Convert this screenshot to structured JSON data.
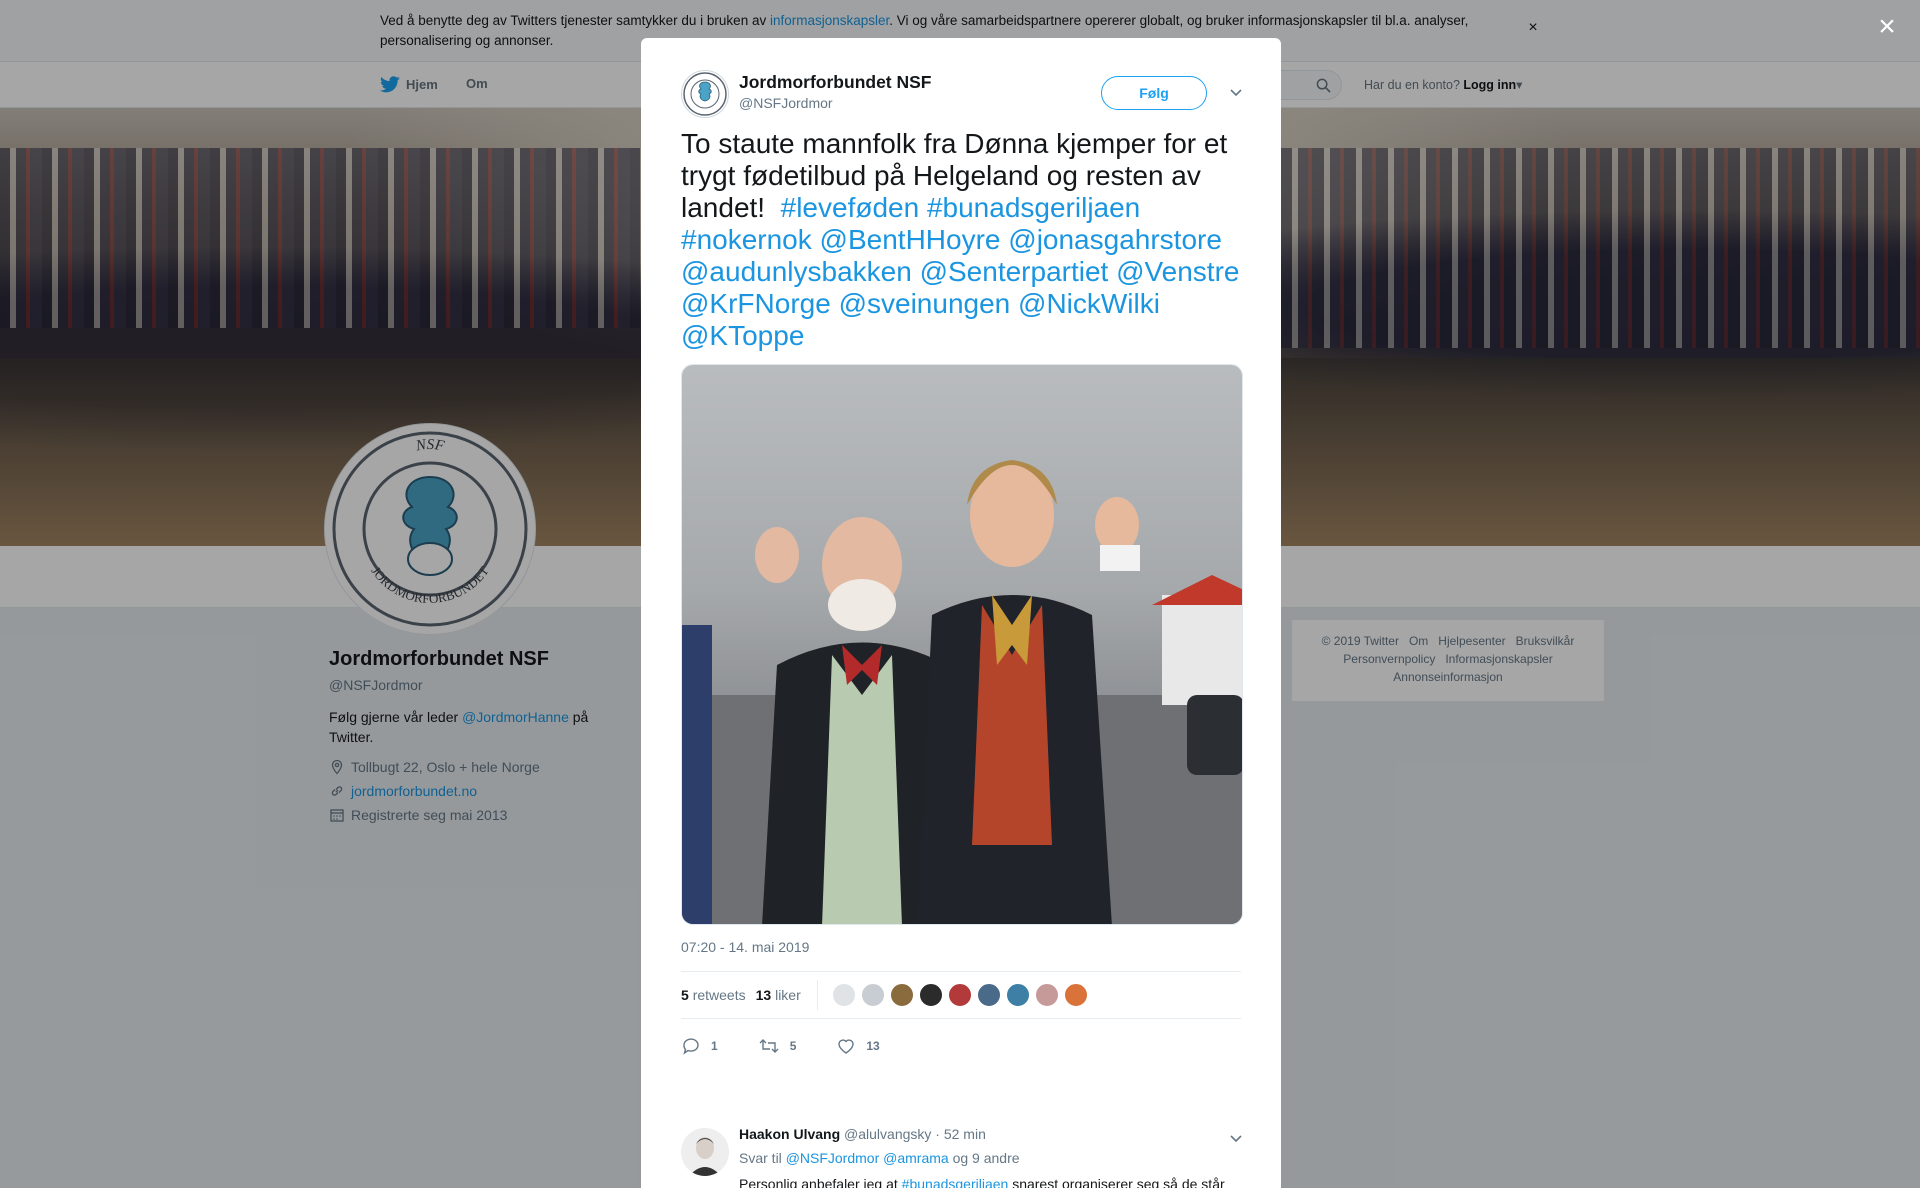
{
  "cookie_bar": {
    "text_before": "Ved å benytte deg av Twitters tjenester samtykker du i bruken av ",
    "link": "informasjonskapsler",
    "text_after": ". Vi og våre samarbeidspartnere opererer globalt, og bruker informasjonskapsler til bl.a. analyser, personalisering og annonser.",
    "close": "×"
  },
  "nav": {
    "home": "Hjem",
    "about": "Om",
    "have_account": "Har du en konto?",
    "login": "Logg inn"
  },
  "profile": {
    "name": "Jordmorforbundet NSF",
    "handle": "@NSFJordmor",
    "bio_before": "Følg gjerne vår leder ",
    "bio_link": "@JordmorHanne",
    "bio_after": " på Twitter.",
    "location": "Tollbugt 22, Oslo + hele Norge",
    "website": "jordmorforbundet.no",
    "joined": "Registrerte seg mai 2013",
    "logo_text_top": "NSF",
    "logo_text_bottom": "JORDMORFORBUNDET"
  },
  "footer": {
    "copyright": "© 2019 Twitter",
    "about": "Om",
    "help": "Hjelpesenter",
    "terms": "Bruksvilkår",
    "privacy": "Personvernpolicy",
    "cookies": "Informasjonskapsler",
    "ads": "Annonseinformasjon"
  },
  "overlay": {
    "close": "×"
  },
  "tweet": {
    "author_name": "Jordmorforbundet NSF",
    "author_handle": "@NSFJordmor",
    "follow": "Følg",
    "text_plain": "To staute mannfolk fra Dønna kjemper for et trygt fødetilbud på Helgeland og resten av landet!",
    "tags": [
      "#leveføden",
      "#bunadsgeriljaen",
      "#nokernok",
      "@BentHHoyre",
      "@jonasgahrstore",
      "@audunlysbakken",
      "@Senterpartiet",
      "@Venstre",
      "@KrFNorge",
      "@sveinungen",
      "@NickWilki",
      "@KToppe"
    ],
    "timestamp": "07:20 - 14. mai 2019",
    "retweets_count": "5",
    "retweets_label": "retweets",
    "likes_count": "13",
    "likes_label": "liker",
    "reply_count": "1",
    "retweet_action_count": "5",
    "like_action_count": "13",
    "liker_colors": [
      "#dfe3e6",
      "#c7cdd2",
      "#8a6b3d",
      "#2b2b2b",
      "#b23a3a",
      "#4a6a8a",
      "#3d7fa5",
      "#c79a9a",
      "#d9733a"
    ]
  },
  "reply": {
    "name": "Haakon Ulvang",
    "handle": "@alulvangsky",
    "time": "· 52 min",
    "reply_to_label": "Svar til",
    "reply_to_users": "@NSFJordmor @amrama",
    "reply_to_more": "og 9 andre",
    "text_before": "Personlig anbefaler jeg at ",
    "text_tag": "#bunadsgeriljaen",
    "text_after": " snarest organiserer seg så de står politisk selvstendig."
  },
  "colors": {
    "accent": "#1da1f2",
    "link": "#1b95e0",
    "secondary_text": "#657786"
  }
}
